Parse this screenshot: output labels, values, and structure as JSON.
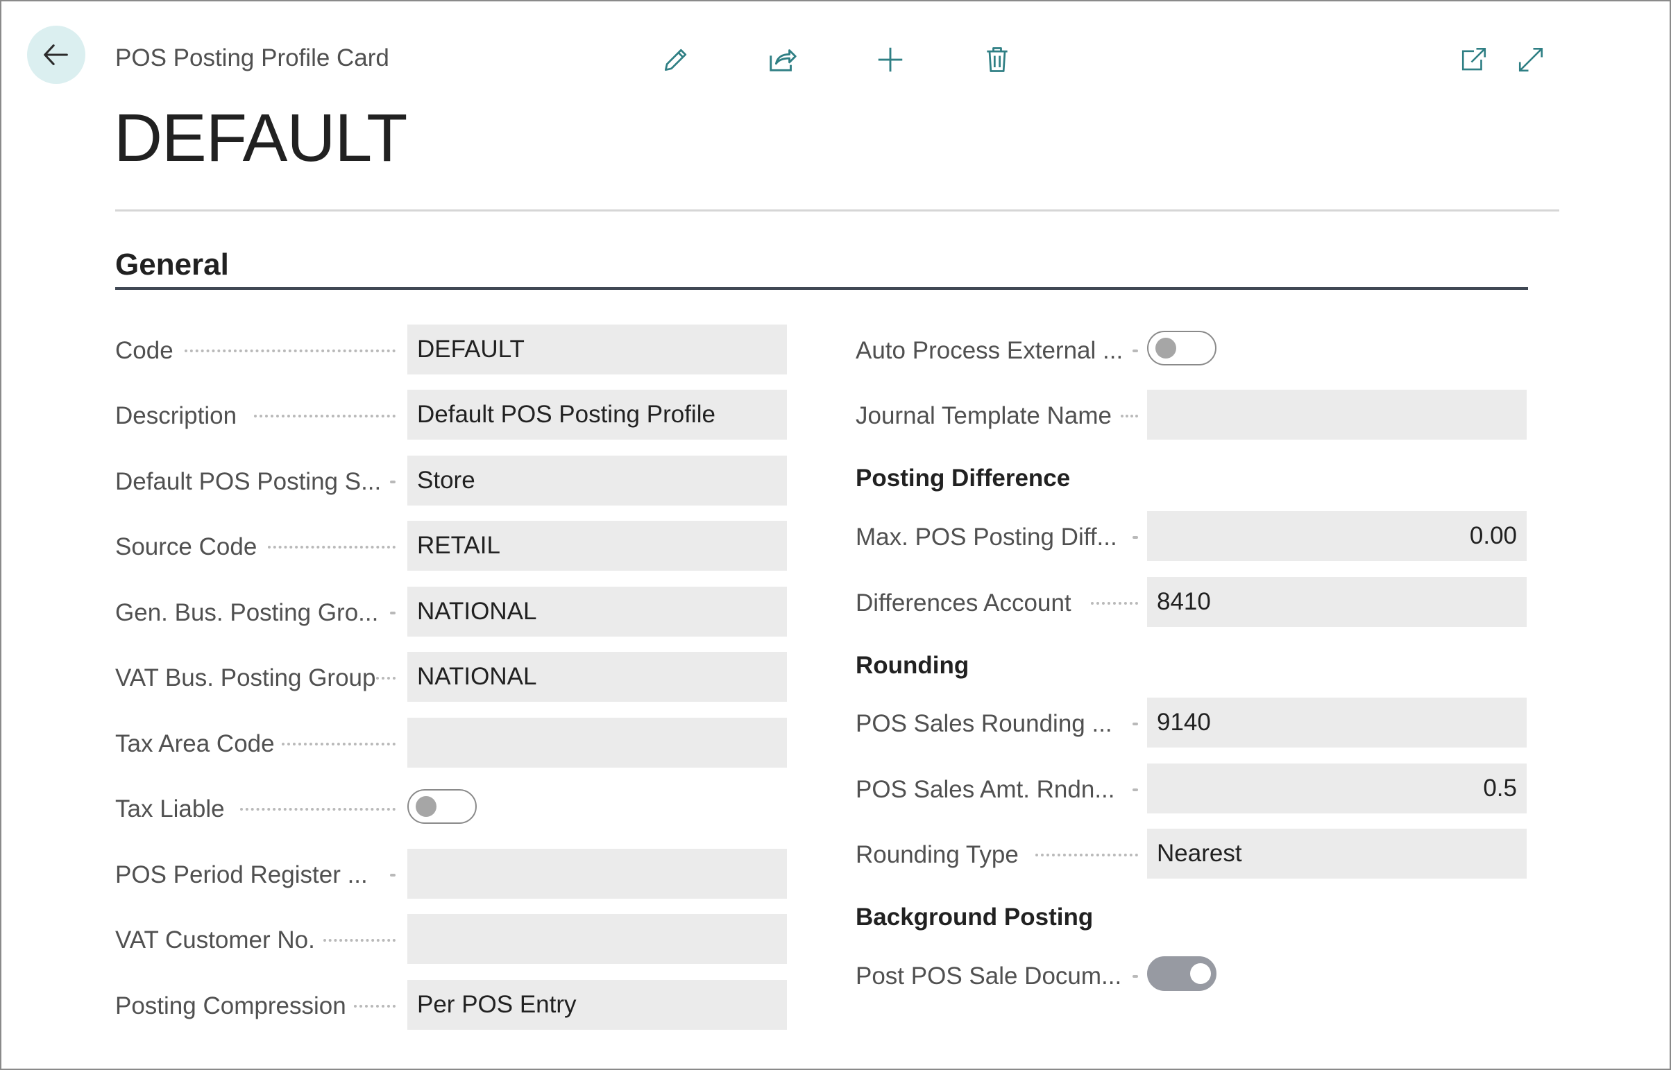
{
  "header": {
    "page_caption": "POS Posting Profile Card",
    "record_title": "DEFAULT",
    "actions": [
      "edit-icon",
      "share-icon",
      "new-icon",
      "delete-icon"
    ],
    "window_actions": [
      "open-in-new-window-icon",
      "expand-icon"
    ]
  },
  "general": {
    "title": "General",
    "left": [
      {
        "label": "Code",
        "value": "DEFAULT"
      },
      {
        "label": "Description",
        "value": "Default POS Posting Profile"
      },
      {
        "label": "Default POS Posting S...",
        "value": "Store"
      },
      {
        "label": "Source Code",
        "value": "RETAIL"
      },
      {
        "label": "Gen. Bus. Posting Gro...",
        "value": "NATIONAL"
      },
      {
        "label": "VAT Bus. Posting Group",
        "value": "NATIONAL"
      },
      {
        "label": "Tax Area Code",
        "value": ""
      },
      {
        "label": "Tax Liable",
        "toggle": false
      },
      {
        "label": "POS Period Register ...",
        "value": ""
      },
      {
        "label": "VAT Customer No.",
        "value": ""
      },
      {
        "label": "Posting Compression",
        "value": "Per POS Entry"
      }
    ],
    "right": {
      "auto_process": {
        "label": "Auto Process External ...",
        "toggle": false
      },
      "journal_template": {
        "label": "Journal Template Name",
        "value": ""
      },
      "posting_difference": {
        "title": "Posting Difference",
        "max_diff": {
          "label": "Max. POS Posting Diff...",
          "value": "0.00"
        },
        "diff_account": {
          "label": "Differences Account",
          "value": "8410"
        }
      },
      "rounding": {
        "title": "Rounding",
        "sales_rounding": {
          "label": "POS Sales Rounding ...",
          "value": "9140"
        },
        "amt_rounding": {
          "label": "POS Sales Amt. Rndn...",
          "value": "0.5"
        },
        "rounding_type": {
          "label": "Rounding Type",
          "value": "Nearest"
        }
      },
      "background_posting": {
        "title": "Background Posting",
        "post_sale": {
          "label": "Post POS Sale Docum...",
          "toggle": true
        }
      }
    }
  },
  "colors": {
    "accent": "#2f7f84",
    "back_button_bg": "#dbeff0",
    "field_bg": "#ebebeb",
    "section_rule": "#404854"
  }
}
